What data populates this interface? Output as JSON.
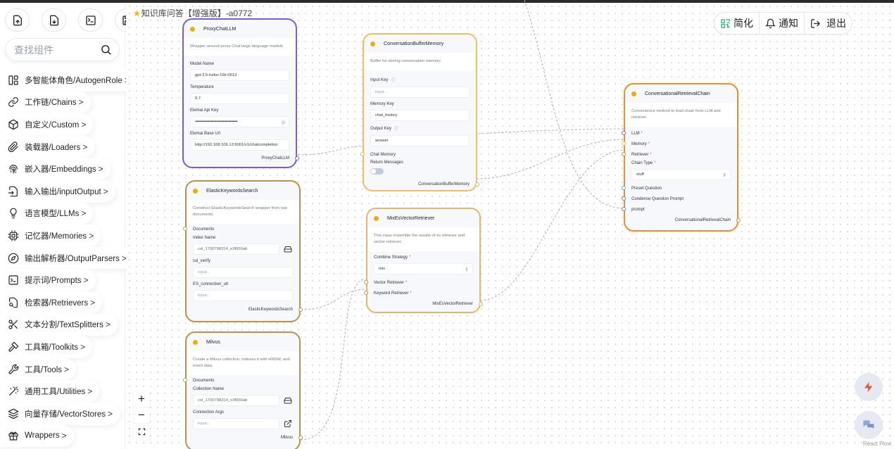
{
  "flow": {
    "title": "知识库问答【增强版】-a0772"
  },
  "toolbar": {
    "buttons": [
      {
        "name": "import-button",
        "icon": "file-upload-icon"
      },
      {
        "name": "export-button",
        "icon": "file-download-icon"
      },
      {
        "name": "code-button",
        "icon": "terminal-icon"
      },
      {
        "name": "save-button",
        "icon": "save-icon"
      }
    ]
  },
  "search": {
    "placeholder": "查找组件",
    "value": ""
  },
  "sidebar": {
    "categories": [
      {
        "label": "多智能体角色/AutogenRole",
        "icon": "layout-icon"
      },
      {
        "label": "工作链/Chains",
        "icon": "link-icon"
      },
      {
        "label": "自定义/Custom",
        "icon": "cube-icon"
      },
      {
        "label": "装载器/Loaders",
        "icon": "paperclip-icon"
      },
      {
        "label": "嵌入器/Embeddings",
        "icon": "fingerprint-icon"
      },
      {
        "label": "输入输出/inputOutput",
        "icon": "file-input-icon"
      },
      {
        "label": "语言模型/LLMs",
        "icon": "lightbulb-icon"
      },
      {
        "label": "记忆器/Memories",
        "icon": "cpu-icon"
      },
      {
        "label": "输出解析器/OutputParsers",
        "icon": "compass-icon"
      },
      {
        "label": "提示词/Prompts",
        "icon": "terminal-square-icon"
      },
      {
        "label": "检索器/Retrievers",
        "icon": "file-search-icon"
      },
      {
        "label": "文本分割/TextSplitters",
        "icon": "scissors-icon"
      },
      {
        "label": "工具箱/Toolkits",
        "icon": "hammer-icon"
      },
      {
        "label": "工具/Tools",
        "icon": "wrench-icon"
      },
      {
        "label": "通用工具/Utilities",
        "icon": "wand-icon"
      },
      {
        "label": "向量存储/VectorStores",
        "icon": "layers-icon"
      },
      {
        "label": "Wrappers",
        "icon": "gift-icon"
      }
    ],
    "chevron": ">"
  },
  "header_actions": [
    {
      "label": "简化",
      "icon": "simplify-icon"
    },
    {
      "label": "通知",
      "icon": "bell-icon"
    },
    {
      "label": "退出",
      "icon": "logout-icon"
    }
  ],
  "nodes": {
    "proxy_chat_llm": {
      "title": "ProxyChatLLM",
      "description": "Wrapper around proxy Chat large language models.",
      "fields": [
        {
          "label": "Model Name",
          "value": "gpt-3.5-turbo-16k-0613"
        },
        {
          "label": "Temperature",
          "value": "0.7"
        },
        {
          "label": "Elemai Api Key",
          "value": "••••••••••••••••••••••••••••••••••••••••••••••••"
        },
        {
          "label": "Elemai Base Url",
          "value": "http://192.168.106.12:6001/v1/chatcompletion"
        }
      ],
      "output": "ProxyChatLLM",
      "border_color": "#7c5cd6"
    },
    "conversation_buffer_memory": {
      "title": "ConversationBufferMemory",
      "description": "Buffer for storing conversation memory.",
      "fields": [
        {
          "label": "Input Key",
          "value": "",
          "placeholder": "input..."
        },
        {
          "label": "Memory Key",
          "value": "chat_history"
        },
        {
          "label": "Output Key",
          "value": "answer"
        }
      ],
      "ports": [
        "Chat Memory"
      ],
      "toggle": {
        "label": "Return Messages",
        "checked": false
      },
      "output": "ConversationBufferMemory",
      "border_color": "#f5bd62"
    },
    "conversational_retrieval_chain": {
      "title": "ConversationalRetrievalChain",
      "description": "Convenience method to load chain from LLM and retriever.",
      "ports": [
        {
          "label": "LLM",
          "required": true
        },
        {
          "label": "Memory",
          "required": true
        },
        {
          "label": "Retriever",
          "required": true
        }
      ],
      "select": {
        "label": "Chain Type",
        "required": true,
        "value": "stuff"
      },
      "ports2": [
        {
          "label": "Preset Question"
        },
        {
          "label": "Condense Question Prompt"
        },
        {
          "label": "prompt"
        }
      ],
      "output": "ConversationalRetrievalChain",
      "border_color": "#f08c2a"
    },
    "elastic_keywords_search": {
      "title": "ElasticKeywordsSearch",
      "description": "Construct ElasticKeywordsSearch wrapper from raw documents.",
      "ports": [
        "Documents"
      ],
      "fields": [
        {
          "label": "Index Name",
          "value": "col_1700798314_e3f656ab"
        },
        {
          "label": "ssl_verify",
          "value": "",
          "placeholder": "input..."
        },
        {
          "label": "ES_connection_url",
          "value": "",
          "placeholder": "input..."
        }
      ],
      "output": "ElasticKeywordsSearch",
      "border_color": "#b8924a"
    },
    "mix_es_vector_retriever": {
      "title": "MixEsVectorRetriever",
      "description": "This class ensemble the results of es retriever and vector retriever.",
      "select": {
        "label": "Combine Strategy",
        "required": true,
        "value": "mix"
      },
      "ports": [
        {
          "label": "Vector Retriever",
          "required": true
        },
        {
          "label": "Keyword Retriever",
          "required": true
        }
      ],
      "output": "MixEsVectorRetriever",
      "border_color": "#e6b566"
    },
    "milvus": {
      "title": "Milvus",
      "description": "Create a Milvus collection, indexes it with HNSW, and insert data.",
      "ports": [
        "Documents"
      ],
      "fields": [
        {
          "label": "Collection Name",
          "value": "col_1700798314_e3f656ab"
        },
        {
          "label": "Connection Args",
          "value": "",
          "placeholder": "input..."
        }
      ],
      "output": "Milvus",
      "border_color": "#b8924a"
    }
  },
  "required_mark": "*",
  "zoom_controls": {
    "zoom_in": "+",
    "zoom_out": "−"
  },
  "attribution": "React Flow",
  "colors": {
    "accent_orange": "#f08c2a",
    "llm_purple": "#7c5cd6",
    "node_dot": "#e6b00b",
    "required": "#e5484d",
    "simplify_green": "#22b573",
    "fab_bolt": "#e5573b"
  }
}
